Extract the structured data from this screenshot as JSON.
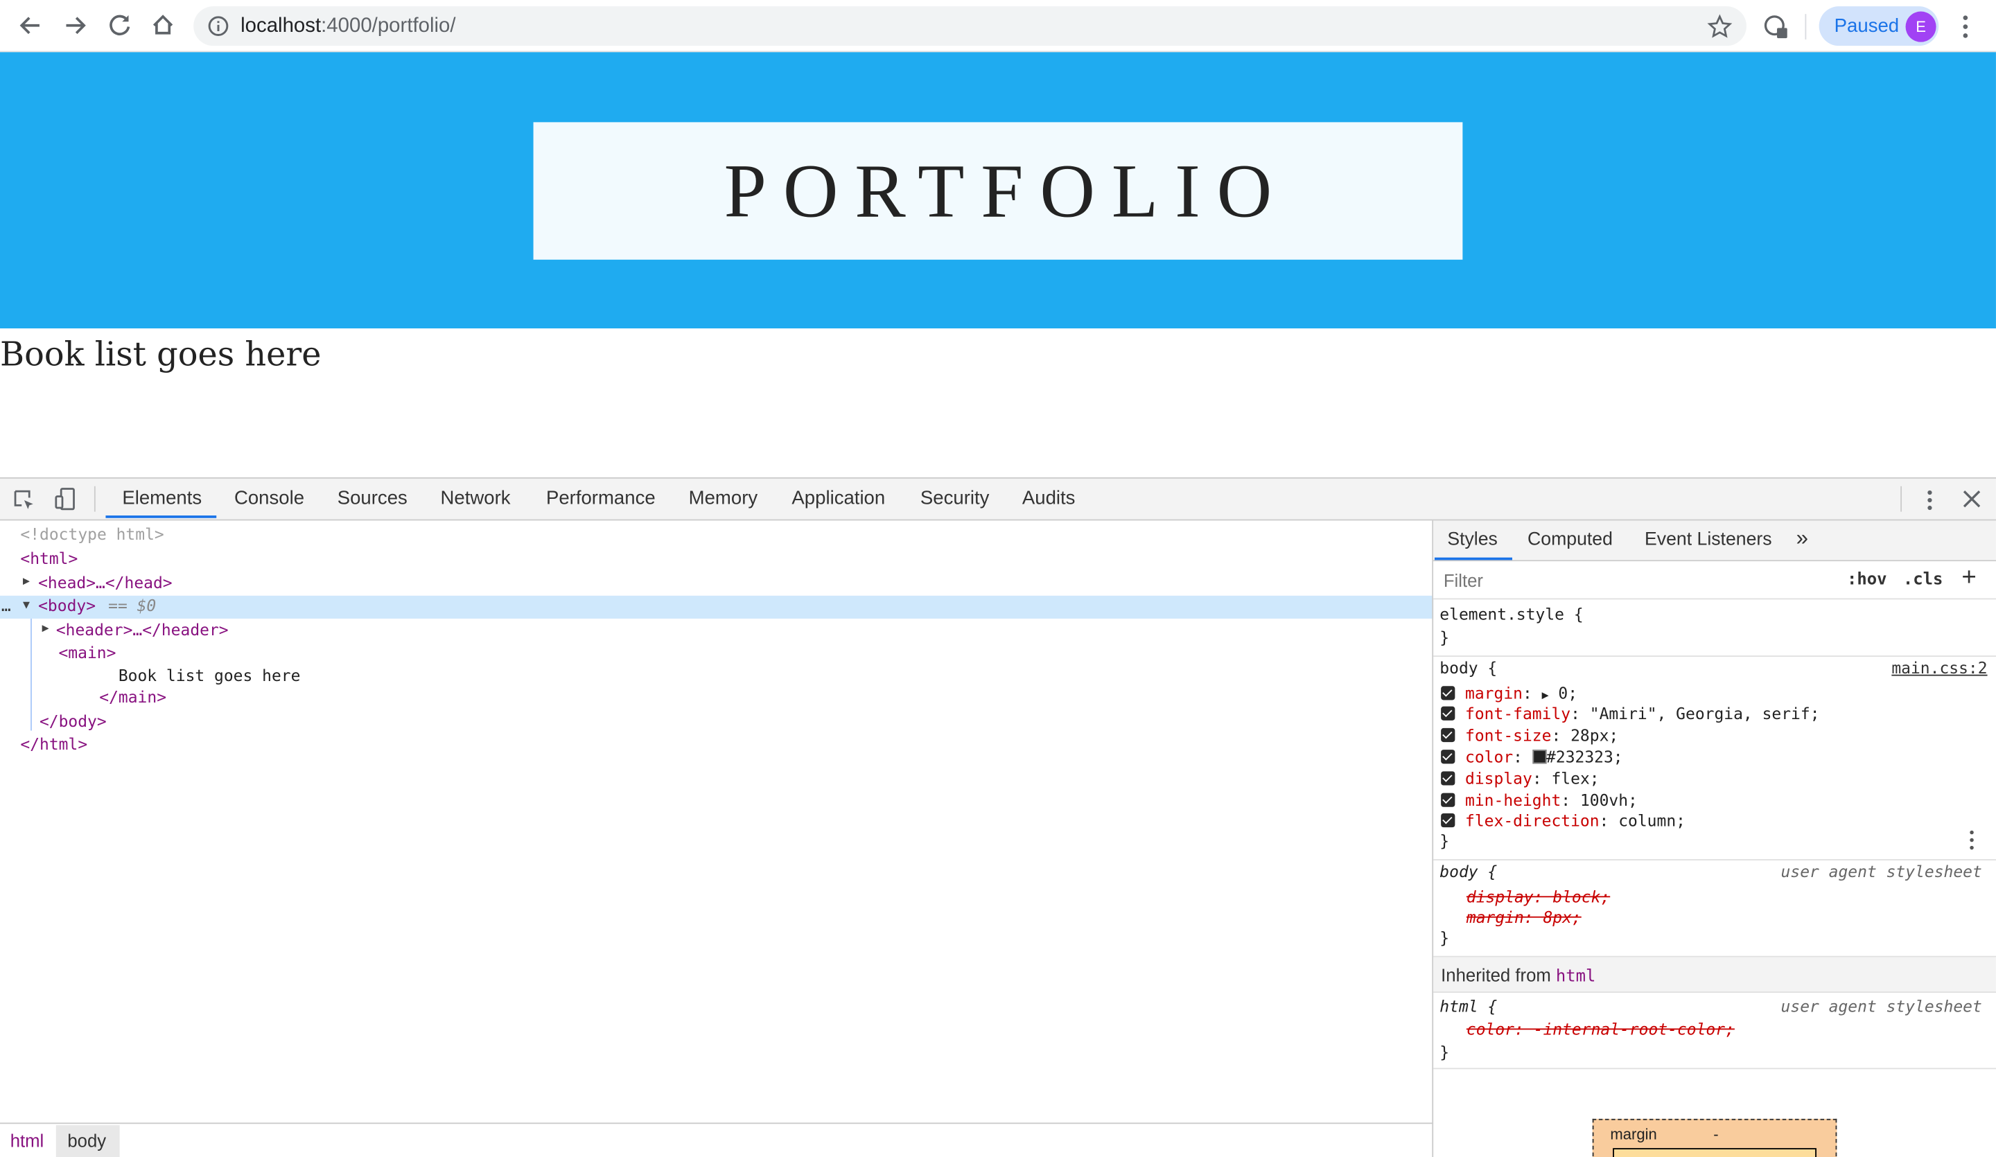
{
  "browser": {
    "url_host": "localhost",
    "url_path": ":4000/portfolio/",
    "profile_status": "Paused",
    "profile_initial": "E"
  },
  "page": {
    "title": "PORTFOLIO",
    "body_text": "Book list goes here"
  },
  "devtools": {
    "tabs": [
      "Elements",
      "Console",
      "Sources",
      "Network",
      "Performance",
      "Memory",
      "Application",
      "Security",
      "Audits"
    ],
    "dom": {
      "doctype": "<!doctype html>",
      "html_open": "<html>",
      "head": "<head>…</head>",
      "body_open": "<body>",
      "body_marker": "== $0",
      "header": "<header>…</header>",
      "main_open": "<main>",
      "main_text": "Book list goes here",
      "main_close": "</main>",
      "body_close": "</body>",
      "html_close": "</html>"
    },
    "breadcrumbs": [
      "html",
      "body"
    ],
    "styles_tabs": [
      "Styles",
      "Computed",
      "Event Listeners"
    ],
    "filter_placeholder": "Filter",
    "hov_label": ":hov",
    "cls_label": ".cls",
    "element_style": "element.style {",
    "close_brace": "}",
    "body_rule": {
      "selector": "body",
      "source": "main.css:2",
      "props": [
        {
          "name": "margin",
          "value": "0;"
        },
        {
          "name": "font-family",
          "value": "\"Amiri\", Georgia, serif;"
        },
        {
          "name": "font-size",
          "value": "28px;"
        },
        {
          "name": "color",
          "value": "#232323;"
        },
        {
          "name": "display",
          "value": "flex;"
        },
        {
          "name": "min-height",
          "value": "100vh;"
        },
        {
          "name": "flex-direction",
          "value": "column;"
        }
      ]
    },
    "ua_rule": {
      "selector": "body",
      "source": "user agent stylesheet",
      "props": [
        "display: block;",
        "margin: 8px;"
      ]
    },
    "inherited_label": "Inherited from",
    "inherited_tag": "html",
    "html_rule": {
      "selector": "html",
      "source": "user agent stylesheet",
      "props": [
        "color: -internal-root-color;"
      ]
    },
    "box_model": {
      "margin_label": "margin",
      "margin_value": "-"
    }
  },
  "colors": {
    "hero": "#1fabf0",
    "swatch": "#232323",
    "tag": "#881280",
    "prop": "#c80000"
  }
}
